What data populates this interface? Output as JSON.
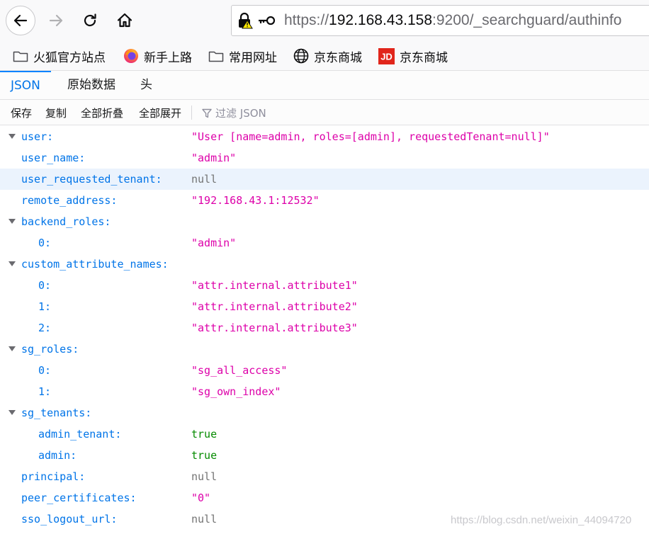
{
  "nav": {
    "back_icon": "arrow-left",
    "forward_icon": "arrow-right",
    "reload_icon": "reload",
    "home_icon": "home",
    "url_prefix": "https://",
    "url_host": "192.168.43.158",
    "url_rest": ":9200/_searchguard/authinfo"
  },
  "bookmarks": [
    {
      "label": "火狐官方站点",
      "icon": "folder-icon"
    },
    {
      "label": "新手上路",
      "icon": "firefox-icon"
    },
    {
      "label": "常用网址",
      "icon": "folder-icon"
    },
    {
      "label": "京东商城",
      "icon": "globe-icon"
    },
    {
      "label": "京东商城",
      "icon": "jd-icon",
      "icon_text": "JD"
    }
  ],
  "tabs": [
    {
      "label": "JSON",
      "selected": true
    },
    {
      "label": "原始数据",
      "selected": false
    },
    {
      "label": "头",
      "selected": false
    }
  ],
  "toolbar": {
    "save": "保存",
    "copy": "复制",
    "collapse_all": "全部折叠",
    "expand_all": "全部展开",
    "filter_placeholder": "过滤 JSON"
  },
  "rows": [
    {
      "key": "user:",
      "value": "\"User [name=admin, roles=[admin], requestedTenant=null]\"",
      "type": "string",
      "level": 0,
      "expander": true
    },
    {
      "key": "user_name:",
      "value": "\"admin\"",
      "type": "string",
      "level": 0,
      "expander": false
    },
    {
      "key": "user_requested_tenant:",
      "value": "null",
      "type": "null",
      "level": 0,
      "expander": false,
      "highlighted": true
    },
    {
      "key": "remote_address:",
      "value": "\"192.168.43.1:12532\"",
      "type": "string",
      "level": 0,
      "expander": false
    },
    {
      "key": "backend_roles:",
      "value": "",
      "type": "object",
      "level": 0,
      "expander": true
    },
    {
      "key": "0:",
      "value": "\"admin\"",
      "type": "string",
      "level": 1,
      "expander": false
    },
    {
      "key": "custom_attribute_names:",
      "value": "",
      "type": "object",
      "level": 0,
      "expander": true
    },
    {
      "key": "0:",
      "value": "\"attr.internal.attribute1\"",
      "type": "string",
      "level": 1,
      "expander": false
    },
    {
      "key": "1:",
      "value": "\"attr.internal.attribute2\"",
      "type": "string",
      "level": 1,
      "expander": false
    },
    {
      "key": "2:",
      "value": "\"attr.internal.attribute3\"",
      "type": "string",
      "level": 1,
      "expander": false
    },
    {
      "key": "sg_roles:",
      "value": "",
      "type": "object",
      "level": 0,
      "expander": true
    },
    {
      "key": "0:",
      "value": "\"sg_all_access\"",
      "type": "string",
      "level": 1,
      "expander": false
    },
    {
      "key": "1:",
      "value": "\"sg_own_index\"",
      "type": "string",
      "level": 1,
      "expander": false
    },
    {
      "key": "sg_tenants:",
      "value": "",
      "type": "object",
      "level": 0,
      "expander": true
    },
    {
      "key": "admin_tenant:",
      "value": "true",
      "type": "bool",
      "level": 1,
      "expander": false
    },
    {
      "key": "admin:",
      "value": "true",
      "type": "bool",
      "level": 1,
      "expander": false
    },
    {
      "key": "principal:",
      "value": "null",
      "type": "null",
      "level": 0,
      "expander": false
    },
    {
      "key": "peer_certificates:",
      "value": "\"0\"",
      "type": "string",
      "level": 0,
      "expander": false
    },
    {
      "key": "sso_logout_url:",
      "value": "null",
      "type": "null",
      "level": 0,
      "expander": false
    }
  ],
  "watermark": "https://blog.csdn.net/weixin_44094720",
  "colors": {
    "key": "#0074e8",
    "string": "#dd00a9",
    "null": "#737373",
    "bool": "#058b00",
    "selected_tab": "#0074e8",
    "highlight_row": "#ebf3fd"
  }
}
